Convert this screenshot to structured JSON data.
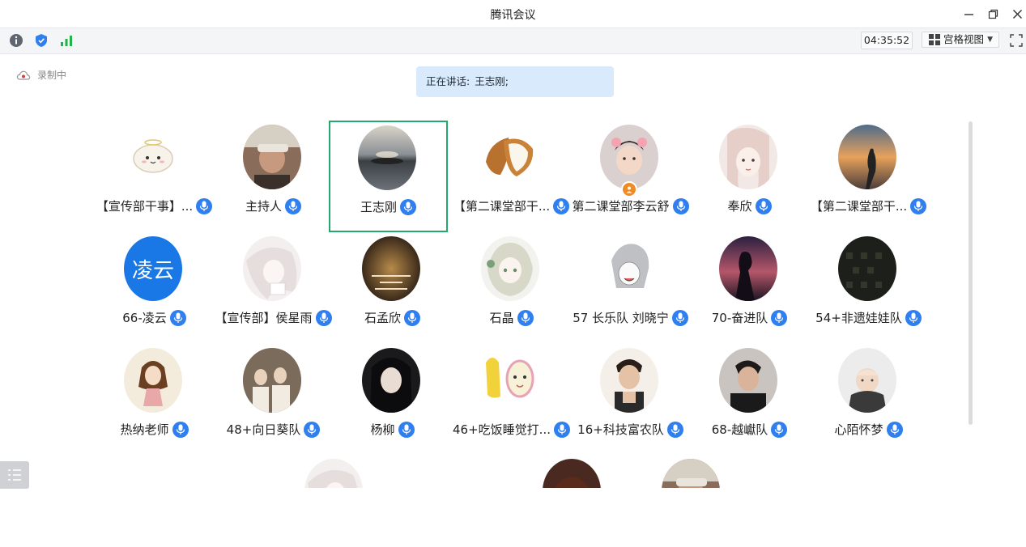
{
  "window": {
    "title": "腾讯会议",
    "controls": [
      "minimize-icon",
      "restore-icon",
      "close-icon"
    ]
  },
  "toolbar": {
    "icons": [
      "info-icon",
      "shield-icon",
      "signal-icon"
    ],
    "timer": "04:35:52",
    "view_label": "宫格视图",
    "fullscreen_icon": "fullscreen-icon"
  },
  "recording": {
    "label": "录制中",
    "icon": "cloud-record-icon"
  },
  "speaking": {
    "prefix": "正在讲话:",
    "name": "王志刚;"
  },
  "colors": {
    "accent": "#2f7ff0",
    "active_border": "#25a86b",
    "speaking_bg": "#d9eafc",
    "host_badge": "#f08a24",
    "lingyun_avatar": "#1a78e6"
  },
  "participants": [
    {
      "name": "【宣传部干事】...",
      "avatar": "cartoon-cloud-avatar"
    },
    {
      "name": "主持人",
      "avatar": "photo-avatar"
    },
    {
      "name": "王志刚",
      "avatar": "sunset-lake-avatar",
      "active": true
    },
    {
      "name": "【第二课堂部干...",
      "avatar": "coconut-avatar"
    },
    {
      "name": "第二课堂部李云舒",
      "avatar": "child-photo-avatar",
      "host": true
    },
    {
      "name": "奉欣",
      "avatar": "illustration-avatar"
    },
    {
      "name": "【第二课堂部干...",
      "avatar": "silhouette-sunset-avatar"
    },
    {
      "name": "66-凌云",
      "avatar": "text-avatar",
      "avatar_text": "凌云"
    },
    {
      "name": "【宣传部】侯星雨",
      "avatar": "anime-avatar"
    },
    {
      "name": "石孟欣",
      "avatar": "poster-avatar"
    },
    {
      "name": "石晶",
      "avatar": "anime-girl-avatar"
    },
    {
      "name": "57 长乐队 刘晓宁",
      "avatar": "anime-sketch-avatar"
    },
    {
      "name": "70-奋进队",
      "avatar": "dusk-silhouette-avatar"
    },
    {
      "name": "54+非遗娃娃队",
      "avatar": "dark-pattern-avatar"
    },
    {
      "name": "热纳老师",
      "avatar": "drawing-avatar"
    },
    {
      "name": "48+向日葵队",
      "avatar": "group-photo-avatar"
    },
    {
      "name": "杨柳",
      "avatar": "portrait-avatar"
    },
    {
      "name": "46+吃饭睡觉打...",
      "avatar": "cartoon-mirror-avatar"
    },
    {
      "name": "16+科技富农队",
      "avatar": "man-photo-avatar"
    },
    {
      "name": "68-越巘队",
      "avatar": "man-dark-avatar"
    },
    {
      "name": "心陌怀梦",
      "avatar": "monk-avatar"
    }
  ],
  "partial_row": [
    "anime-avatar",
    "woman-photo-avatar",
    "photo-avatar"
  ]
}
